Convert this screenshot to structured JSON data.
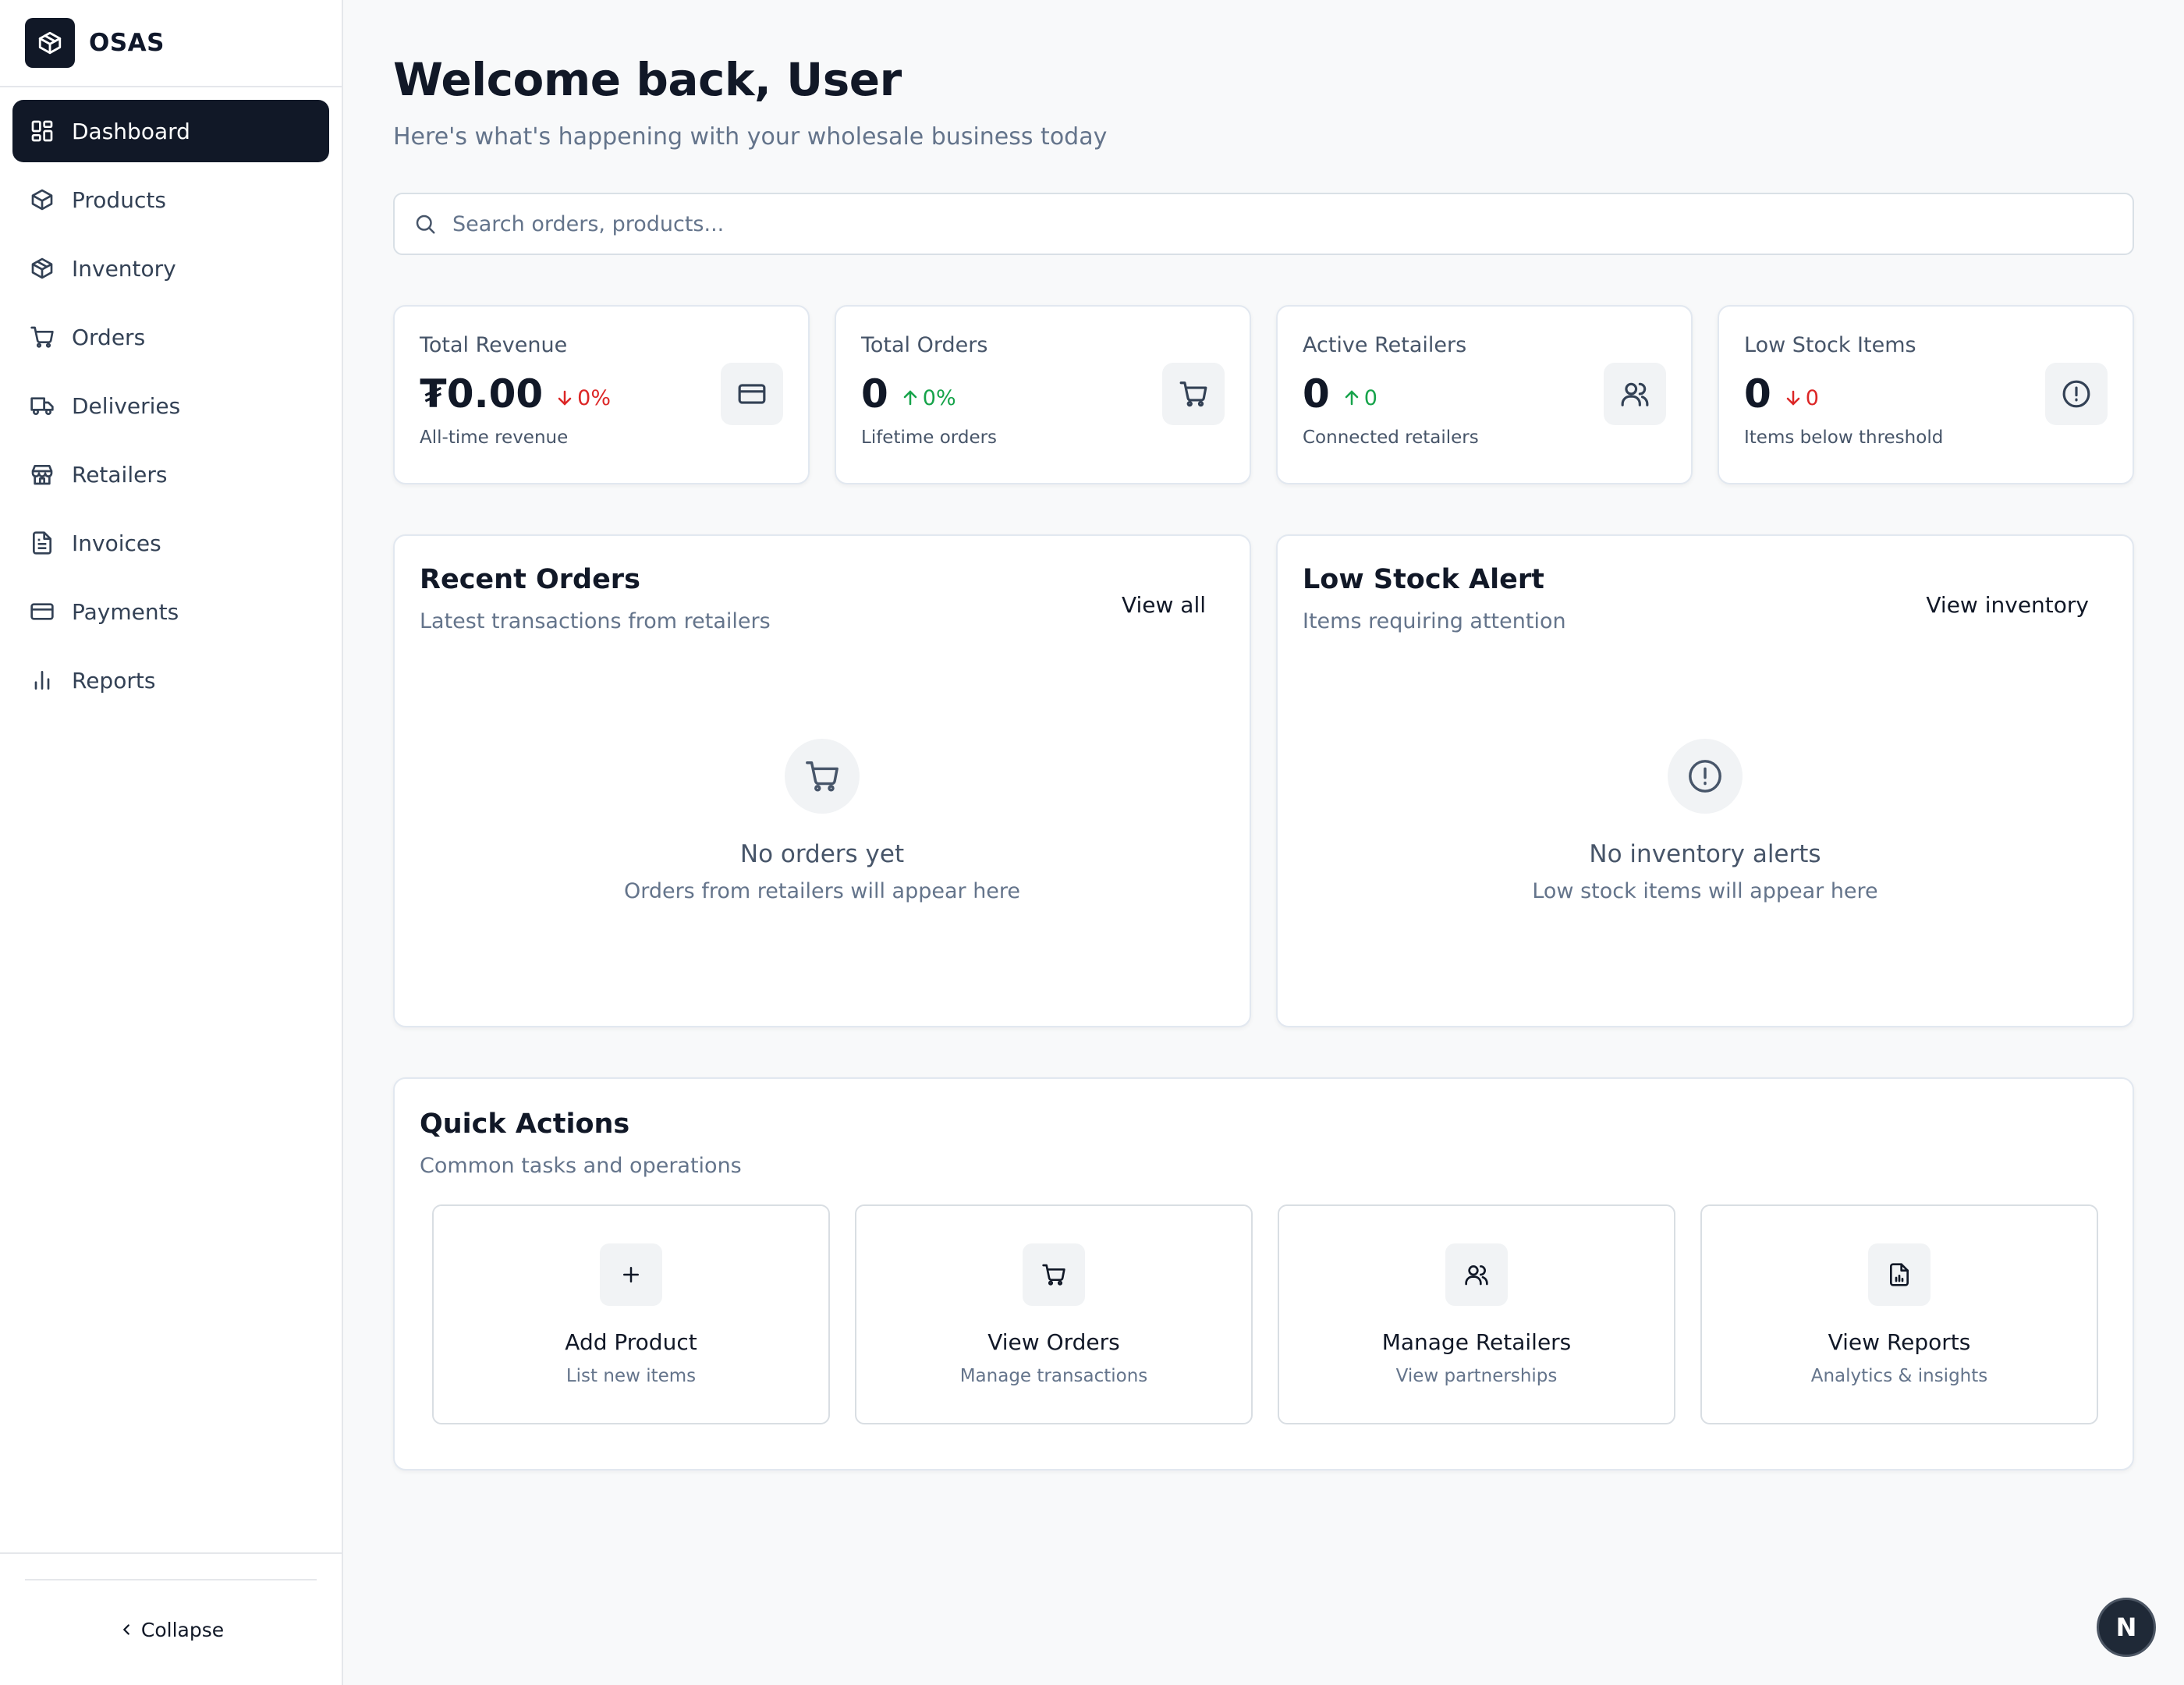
{
  "brand": {
    "name": "OSAS"
  },
  "sidebar": {
    "items": [
      {
        "label": "Dashboard",
        "icon": "dashboard-icon",
        "active": true
      },
      {
        "label": "Products",
        "icon": "package-icon"
      },
      {
        "label": "Inventory",
        "icon": "box-icon"
      },
      {
        "label": "Orders",
        "icon": "cart-icon"
      },
      {
        "label": "Deliveries",
        "icon": "truck-icon"
      },
      {
        "label": "Retailers",
        "icon": "store-icon"
      },
      {
        "label": "Invoices",
        "icon": "file-icon"
      },
      {
        "label": "Payments",
        "icon": "credit-card-icon"
      },
      {
        "label": "Reports",
        "icon": "bar-chart-icon"
      }
    ],
    "collapse_label": "Collapse"
  },
  "header": {
    "title": "Welcome back, User",
    "subtitle": "Here's what's happening with your wholesale business today"
  },
  "search": {
    "placeholder": "Search orders, products...",
    "value": ""
  },
  "stats": [
    {
      "label": "Total Revenue",
      "value": "₮0.00",
      "delta": "0%",
      "direction": "down",
      "caption": "All-time revenue",
      "icon": "credit-card-icon"
    },
    {
      "label": "Total Orders",
      "value": "0",
      "delta": "0%",
      "direction": "up",
      "caption": "Lifetime orders",
      "icon": "cart-icon"
    },
    {
      "label": "Active Retailers",
      "value": "0",
      "delta": "0",
      "direction": "up",
      "caption": "Connected retailers",
      "icon": "users-icon"
    },
    {
      "label": "Low Stock Items",
      "value": "0",
      "delta": "0",
      "direction": "down",
      "caption": "Items below threshold",
      "icon": "alert-circle-icon"
    }
  ],
  "recent_orders": {
    "title": "Recent Orders",
    "subtitle": "Latest transactions from retailers",
    "link": "View all",
    "empty_title": "No orders yet",
    "empty_sub": "Orders from retailers will appear here"
  },
  "low_stock": {
    "title": "Low Stock Alert",
    "subtitle": "Items requiring attention",
    "link": "View inventory",
    "empty_title": "No inventory alerts",
    "empty_sub": "Low stock items will appear here"
  },
  "quick_actions": {
    "title": "Quick Actions",
    "subtitle": "Common tasks and operations",
    "items": [
      {
        "title": "Add Product",
        "sub": "List new items",
        "icon": "plus-icon"
      },
      {
        "title": "View Orders",
        "sub": "Manage transactions",
        "icon": "cart-icon"
      },
      {
        "title": "Manage Retailers",
        "sub": "View partnerships",
        "icon": "users-icon"
      },
      {
        "title": "View Reports",
        "sub": "Analytics & insights",
        "icon": "report-file-icon"
      }
    ]
  },
  "fab": {
    "label": "N"
  },
  "colors": {
    "accent": "#111827",
    "down": "#dc2626",
    "up": "#16a34a",
    "background": "#f8f9fa"
  }
}
